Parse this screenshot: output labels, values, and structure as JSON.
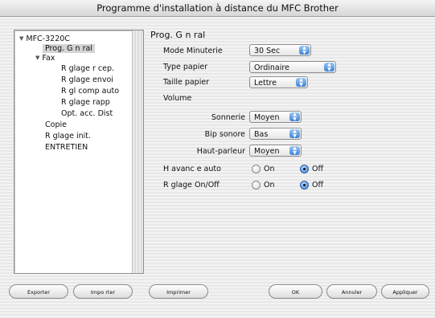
{
  "window": {
    "title": "Programme d'installation à distance du MFC Brother"
  },
  "tree": {
    "root": "MFC-3220C",
    "items": [
      {
        "label": "Prog. G n ral",
        "selected": true
      },
      {
        "label": "Fax"
      },
      {
        "label": "R glage r cep."
      },
      {
        "label": "R glage envoi"
      },
      {
        "label": "R gl comp auto"
      },
      {
        "label": "R glage rapp"
      },
      {
        "label": "Opt. acc. Dist"
      },
      {
        "label": "Copie"
      },
      {
        "label": "R glage init."
      },
      {
        "label": "ENTRETIEN"
      }
    ]
  },
  "panel": {
    "title": "Prog. G n ral",
    "mode_minuterie": {
      "label": "Mode Minuterie",
      "value": "30 Sec"
    },
    "type_papier": {
      "label": "Type papier",
      "value": "Ordinaire"
    },
    "taille_papier": {
      "label": "Taille papier",
      "value": "Lettre"
    },
    "volume": {
      "label": "Volume"
    },
    "sonnerie": {
      "label": "Sonnerie",
      "value": "Moyen"
    },
    "bip_sonore": {
      "label": "Bip sonore",
      "value": "Bas"
    },
    "haut_parleur": {
      "label": "Haut-parleur",
      "value": "Moyen"
    },
    "h_avanc_auto": {
      "label": "H avanc e auto",
      "on_label": "On",
      "off_label": "Off",
      "selected": "Off"
    },
    "rglage_onoff": {
      "label": "R glage On/Off",
      "on_label": "On",
      "off_label": "Off",
      "selected": "Off"
    }
  },
  "buttons": {
    "exporter": "Exporter",
    "importer": "Impo rter",
    "imprimer": "Imprimer",
    "ok": "OK",
    "annuler": "Annuler",
    "appliquer": "Appliquer"
  },
  "colors": {
    "accent": "#3b82d8"
  }
}
